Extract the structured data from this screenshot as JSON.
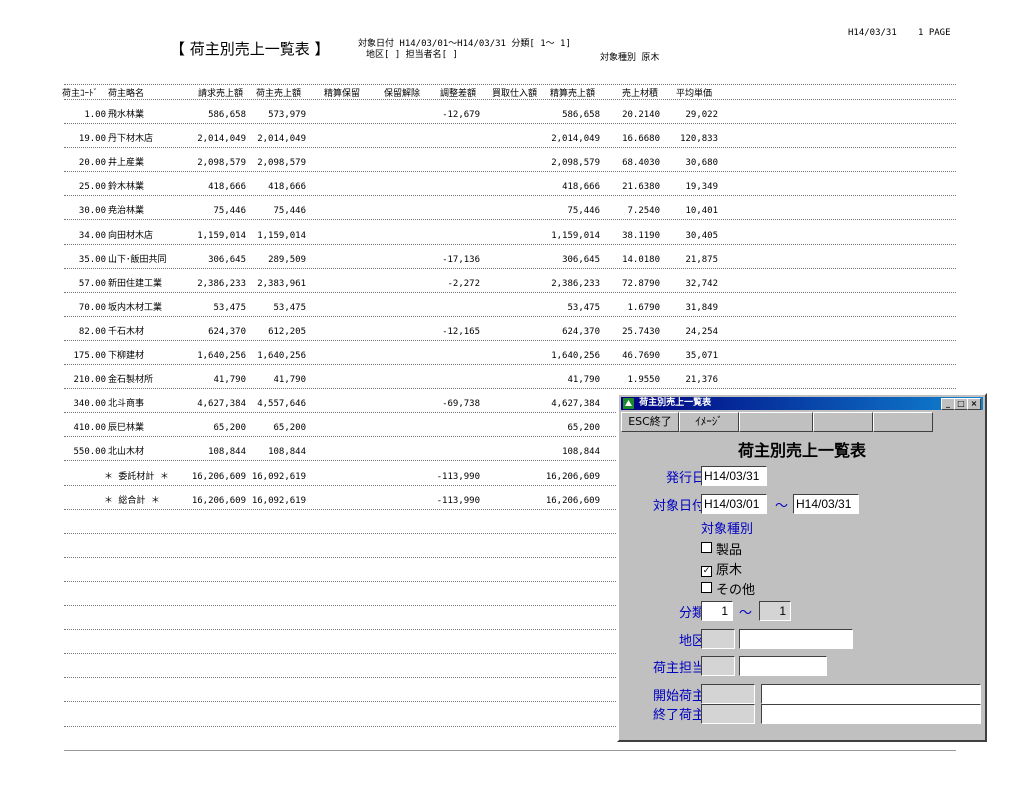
{
  "report": {
    "title": "【 荷主別売上一覧表 】",
    "date_range": "対象日付 H14/03/01～H14/03/31 分類[   1～   1]",
    "area_line": "地区[                    ] 担当者名[                  ]",
    "target_type": "対象種別  原木",
    "print_date": "H14/03/31",
    "page": "1 PAGE",
    "columns": [
      "荷主ｺｰﾄﾞ",
      "荷主略名",
      "請求売上額",
      "荷主売上額",
      "精算保留",
      "保留解除",
      "調整差額",
      "買取仕入額",
      "精算売上額",
      "売上材積",
      "平均単価"
    ],
    "rows": [
      {
        "code": "1.00",
        "name": "飛水林業",
        "billing": "586,658",
        "sales": "573,979",
        "adjust": "-12,679",
        "settle": "586,658",
        "volume": "20.2140",
        "avg": "29,022"
      },
      {
        "code": "19.00",
        "name": "丹下材木店",
        "billing": "2,014,049",
        "sales": "2,014,049",
        "adjust": "",
        "settle": "2,014,049",
        "volume": "16.6680",
        "avg": "120,833"
      },
      {
        "code": "20.00",
        "name": "井上産業",
        "billing": "2,098,579",
        "sales": "2,098,579",
        "adjust": "",
        "settle": "2,098,579",
        "volume": "68.4030",
        "avg": "30,680"
      },
      {
        "code": "25.00",
        "name": "鈴木林業",
        "billing": "418,666",
        "sales": "418,666",
        "adjust": "",
        "settle": "418,666",
        "volume": "21.6380",
        "avg": "19,349"
      },
      {
        "code": "30.00",
        "name": "尭治林業",
        "billing": "75,446",
        "sales": "75,446",
        "adjust": "",
        "settle": "75,446",
        "volume": "7.2540",
        "avg": "10,401"
      },
      {
        "code": "34.00",
        "name": "向田材木店",
        "billing": "1,159,014",
        "sales": "1,159,014",
        "adjust": "",
        "settle": "1,159,014",
        "volume": "38.1190",
        "avg": "30,405"
      },
      {
        "code": "35.00",
        "name": "山下･飯田共同",
        "billing": "306,645",
        "sales": "289,509",
        "adjust": "-17,136",
        "settle": "306,645",
        "volume": "14.0180",
        "avg": "21,875"
      },
      {
        "code": "57.00",
        "name": "新田住建工業",
        "billing": "2,386,233",
        "sales": "2,383,961",
        "adjust": "-2,272",
        "settle": "2,386,233",
        "volume": "72.8790",
        "avg": "32,742"
      },
      {
        "code": "70.00",
        "name": "坂内木材工業",
        "billing": "53,475",
        "sales": "53,475",
        "adjust": "",
        "settle": "53,475",
        "volume": "1.6790",
        "avg": "31,849"
      },
      {
        "code": "82.00",
        "name": "千石木材",
        "billing": "624,370",
        "sales": "612,205",
        "adjust": "-12,165",
        "settle": "624,370",
        "volume": "25.7430",
        "avg": "24,254"
      },
      {
        "code": "175.00",
        "name": "下柳建材",
        "billing": "1,640,256",
        "sales": "1,640,256",
        "adjust": "",
        "settle": "1,640,256",
        "volume": "46.7690",
        "avg": "35,071"
      },
      {
        "code": "210.00",
        "name": "金石製材所",
        "billing": "41,790",
        "sales": "41,790",
        "adjust": "",
        "settle": "41,790",
        "volume": "1.9550",
        "avg": "21,376"
      },
      {
        "code": "340.00",
        "name": "北斗商事",
        "billing": "4,627,384",
        "sales": "4,557,646",
        "adjust": "-69,738",
        "settle": "4,627,384",
        "volume": "",
        "avg": ""
      },
      {
        "code": "410.00",
        "name": "辰巳林業",
        "billing": "65,200",
        "sales": "65,200",
        "adjust": "",
        "settle": "65,200",
        "volume": "",
        "avg": ""
      },
      {
        "code": "550.00",
        "name": "北山木材",
        "billing": "108,844",
        "sales": "108,844",
        "adjust": "",
        "settle": "108,844",
        "volume": "",
        "avg": ""
      }
    ],
    "totals": [
      {
        "label": "＊ 委託材計 ＊",
        "billing": "16,206,609",
        "sales": "16,092,619",
        "adjust": "-113,990",
        "settle": "16,206,609"
      },
      {
        "label": "＊ 総合計 ＊",
        "billing": "16,206,609",
        "sales": "16,092,619",
        "adjust": "-113,990",
        "settle": "16,206,609"
      }
    ]
  },
  "dialog": {
    "title": "荷主別売上一覧表",
    "esc_label": "ESC終了",
    "image_label": "ｲﾒｰｼﾞ",
    "heading": "荷主別売上一覧表",
    "issue_date_label": "発行日",
    "issue_date": "H14/03/31",
    "target_date_label": "対象日付",
    "date_from": "H14/03/01",
    "tilde": "～",
    "date_to": "H14/03/31",
    "target_type_label": "対象種別",
    "options": [
      {
        "label": "製品",
        "checked": false
      },
      {
        "label": "原木",
        "checked": true
      },
      {
        "label": "その他",
        "checked": false
      }
    ],
    "class_label": "分類",
    "class_from": "1",
    "class_to": "1",
    "area_label": "地区",
    "owner_label": "荷主担当",
    "start_label": "開始荷主",
    "end_label": "終了荷主"
  }
}
